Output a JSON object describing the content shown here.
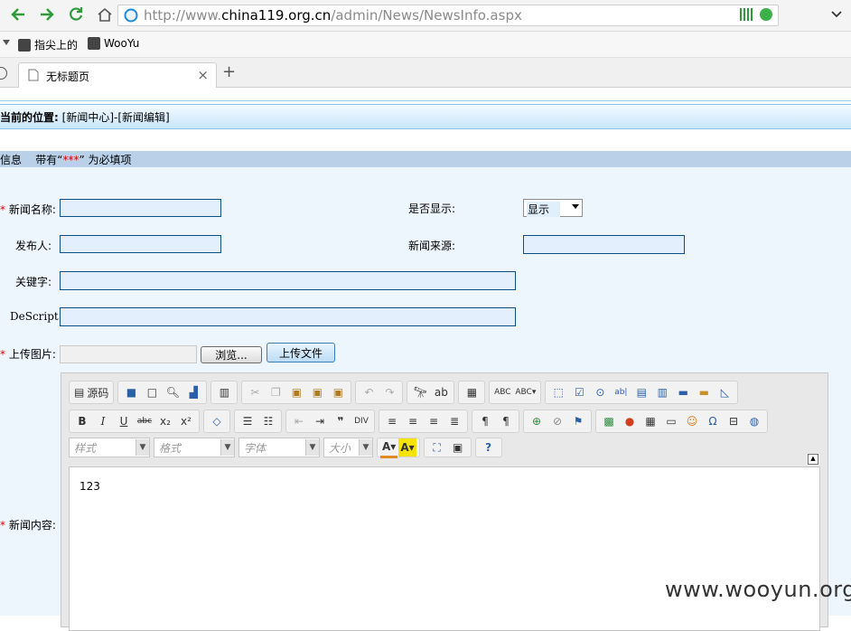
{
  "browser": {
    "url_prefix": "http://www.",
    "url_domain": "china119.org.cn",
    "url_path": "/admin/News/NewsInfo.aspx",
    "bookmarks": [
      "指尖上的",
      "WooYu"
    ],
    "tab_title": "无标题页",
    "new_tab": "+",
    "close_tab": "×"
  },
  "page": {
    "position_label": "当前的位置:",
    "position_value": "[新闻中心]-[新闻编辑]",
    "section_prefix": "信息",
    "section_note_a": "带有“",
    "section_stars": "***",
    "section_note_b": "” 为必填项"
  },
  "form": {
    "req_mark": "*",
    "news_name_label": "新闻名称:",
    "display_label": "是否显示:",
    "display_value": "显示",
    "publisher_label": "发布人:",
    "source_label": "新闻来源:",
    "keyword_label": "关键字:",
    "descript_label": "DeScript:",
    "upload_label": "上传图片:",
    "browse_button": "浏览...",
    "upload_button": "上传文件",
    "content_label": "新闻内容:"
  },
  "editor": {
    "source_label": "源码",
    "style_placeholder": "样式",
    "format_placeholder": "格式",
    "font_placeholder": "字体",
    "size_placeholder": "大小",
    "content": "123"
  },
  "watermark": "www.wooyun.org"
}
